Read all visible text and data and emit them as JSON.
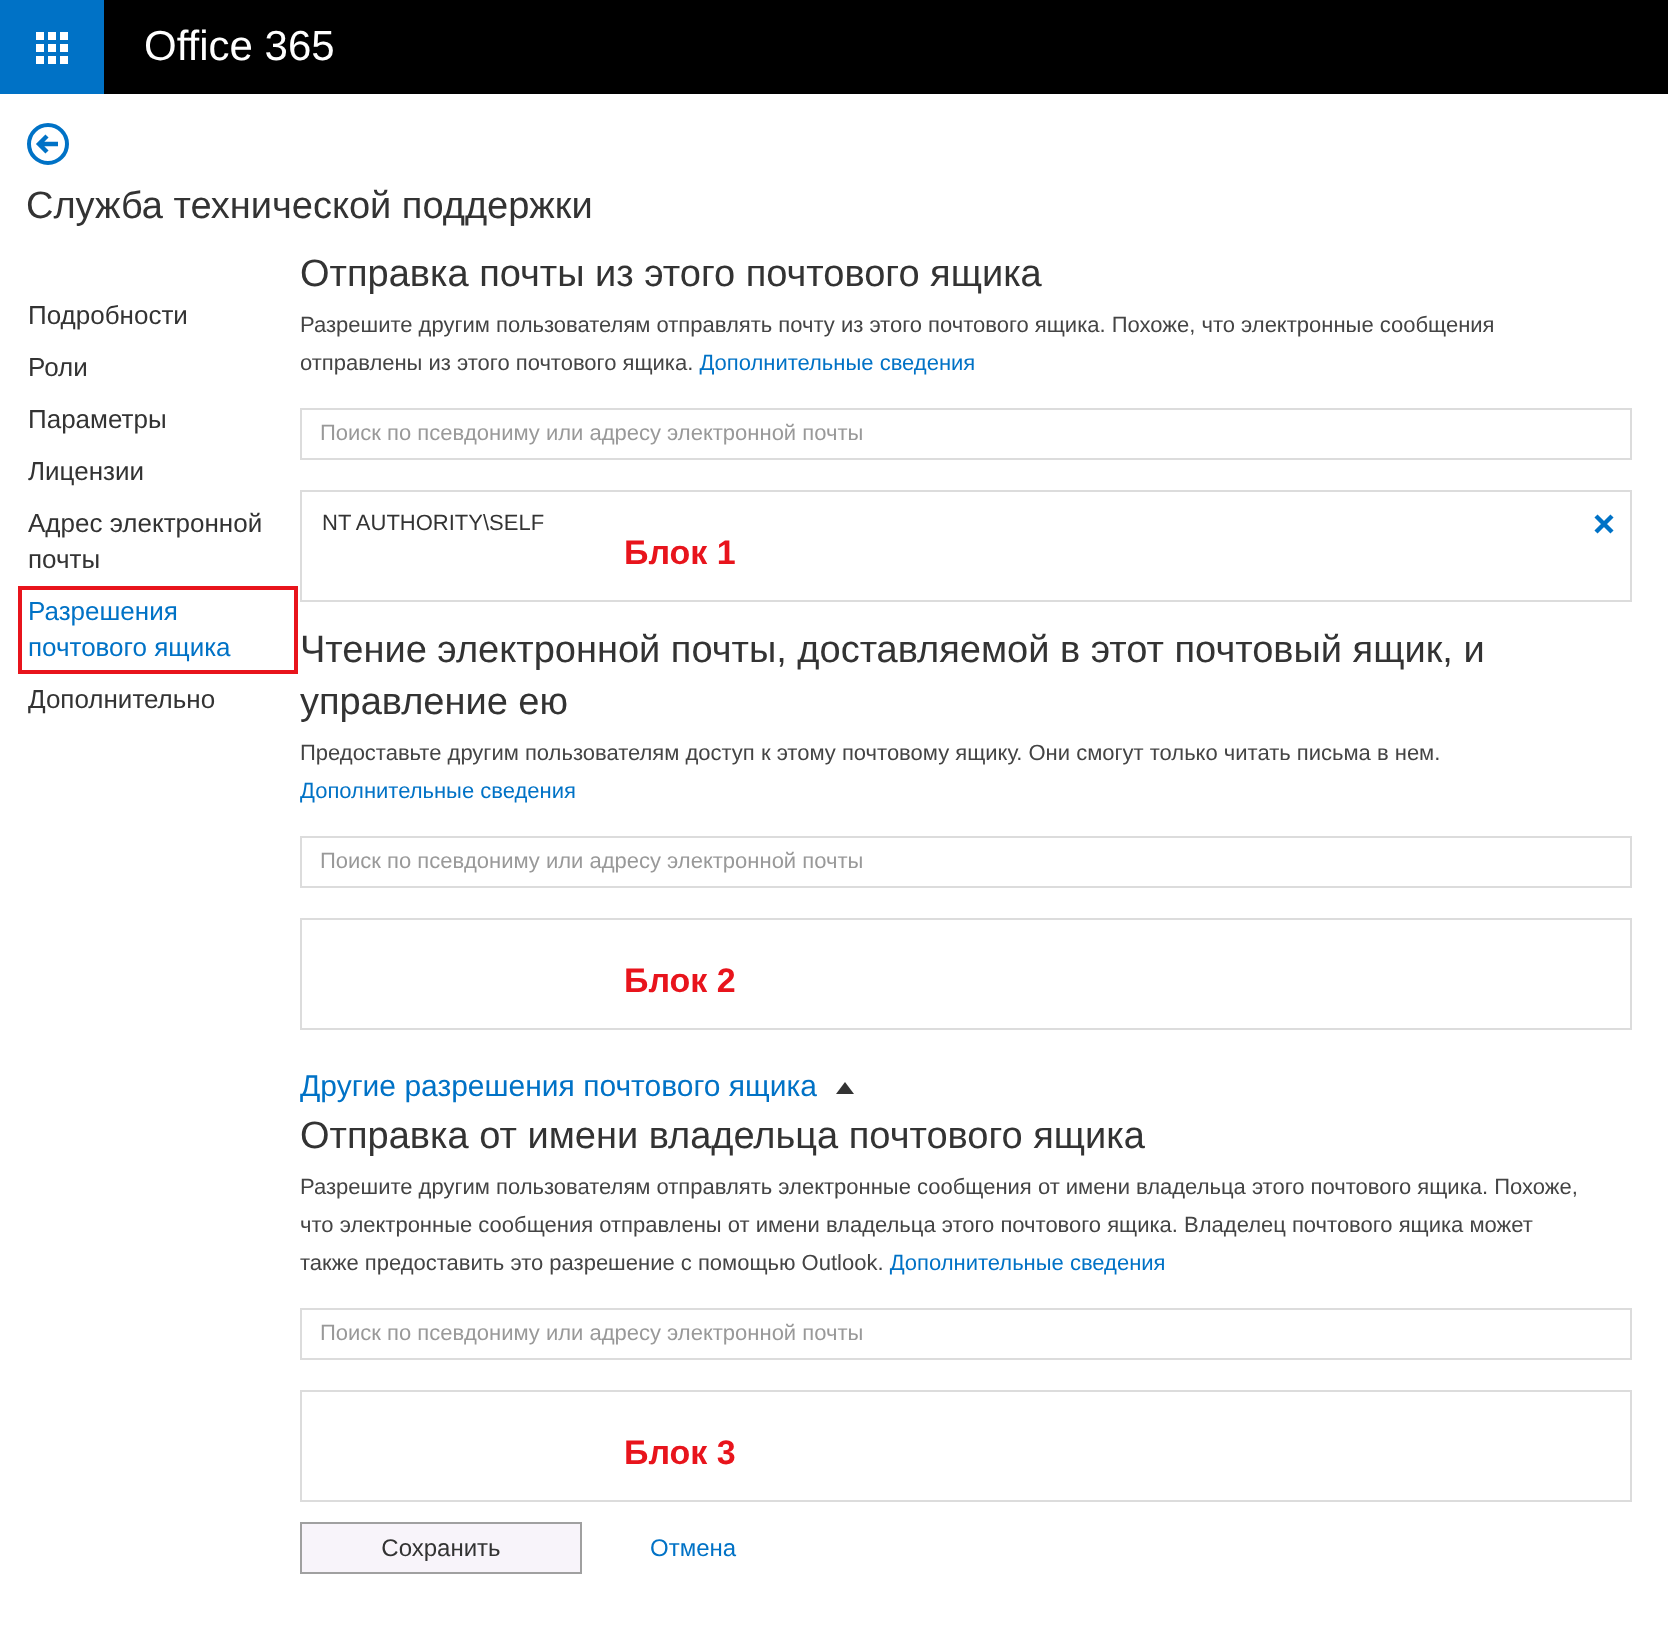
{
  "header": {
    "title": "Office 365"
  },
  "page_title": "Служба технической поддержки",
  "nav": [
    {
      "label": "Подробности",
      "selected": false,
      "annotated": false
    },
    {
      "label": "Роли",
      "selected": false,
      "annotated": false
    },
    {
      "label": "Параметры",
      "selected": false,
      "annotated": false
    },
    {
      "label": "Лицензии",
      "selected": false,
      "annotated": false
    },
    {
      "label": "Адрес электронной почты",
      "selected": false,
      "annotated": false
    },
    {
      "label": "Разрешения почтового ящика",
      "selected": true,
      "annotated": true
    },
    {
      "label": "Дополнительно",
      "selected": false,
      "annotated": false
    }
  ],
  "sections": [
    {
      "title": "Отправка почты из этого почтового ящика",
      "description": "Разрешите другим пользователям отправлять почту из этого почтового ящика. Похоже, что электронные сообщения отправлены из этого почтового ящика.",
      "link": "Дополнительные сведения",
      "search_placeholder": "Поиск по псевдониму или адресу электронной почты",
      "entries": [
        "NT AUTHORITY\\SELF"
      ],
      "annotation": "Блок 1"
    },
    {
      "title": "Чтение электронной почты, доставляемой в этот почтовый ящик, и управление ею",
      "description": "Предоставьте другим пользователям доступ к этому почтовому ящику. Они смогут только читать письма в нем.",
      "link": "Дополнительные сведения",
      "search_placeholder": "Поиск по псевдониму или адресу электронной почты",
      "annotation": "Блок 2"
    }
  ],
  "more_toggle": {
    "label": "Другие разрешения почтового ящика",
    "expanded": true
  },
  "extra_sections": [
    {
      "title": "Отправка от имени владельца почтового ящика",
      "description": "Разрешите другим пользователям отправлять электронные сообщения от имени владельца этого почтового ящика. Похоже, что электронные сообщения отправлены от имени владельца этого почтового ящика. Владелец почтового ящика может также предоставить это разрешение с помощью Outlook.",
      "link": "Дополнительные сведения",
      "search_placeholder": "Поиск по псевдониму или адресу электронной почты",
      "annotation": "Блок 3"
    }
  ],
  "actions": {
    "save": "Сохранить",
    "cancel": "Отмена"
  }
}
